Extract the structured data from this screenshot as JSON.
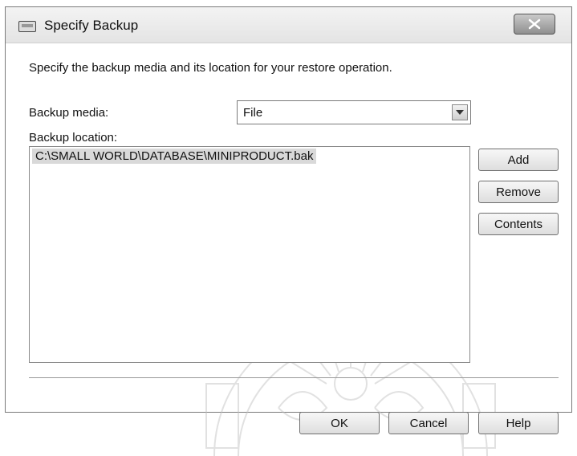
{
  "window": {
    "title": "Specify Backup"
  },
  "instruction": "Specify the backup media and its location for your restore operation.",
  "backup_media": {
    "label": "Backup media:",
    "value": "File"
  },
  "backup_location": {
    "label": "Backup location:",
    "items": [
      "C:\\SMALL WORLD\\DATABASE\\MINIPRODUCT.bak"
    ]
  },
  "side_buttons": {
    "add": "Add",
    "remove": "Remove",
    "contents": "Contents"
  },
  "bottom_buttons": {
    "ok": "OK",
    "cancel": "Cancel",
    "help": "Help"
  }
}
